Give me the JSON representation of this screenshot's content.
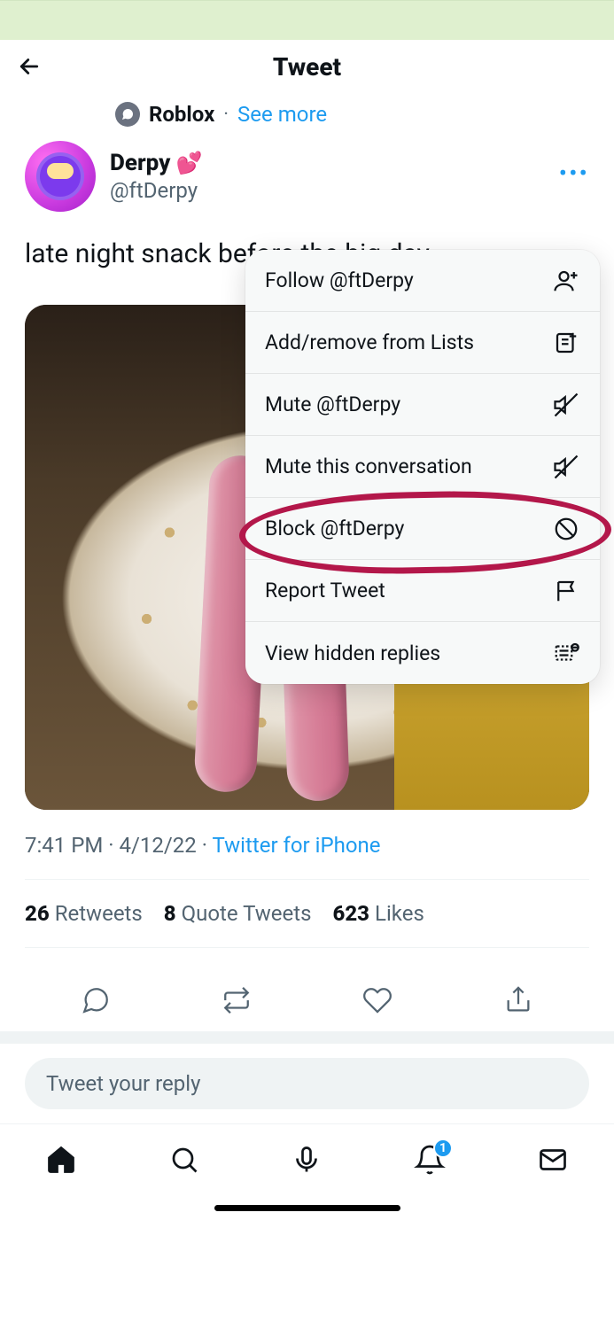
{
  "header": {
    "title": "Tweet"
  },
  "topic": {
    "name": "Roblox",
    "see_more": "See more"
  },
  "user": {
    "display_name": "Derpy",
    "emoji": "💕",
    "handle": "@ftDerpy"
  },
  "tweet_text": "late night snack before the big day",
  "meta": {
    "time": "7:41 PM",
    "date": "4/12/22",
    "source": "Twitter for iPhone"
  },
  "stats": {
    "retweets_count": "26",
    "retweets_label": "Retweets",
    "quotes_count": "8",
    "quotes_label": "Quote Tweets",
    "likes_count": "623",
    "likes_label": "Likes"
  },
  "reply_placeholder": "Tweet your reply",
  "notification_badge": "1",
  "menu": {
    "items": [
      {
        "label": "Follow @ftDerpy",
        "icon": "follow"
      },
      {
        "label": "Add/remove from Lists",
        "icon": "list"
      },
      {
        "label": "Mute @ftDerpy",
        "icon": "mute"
      },
      {
        "label": "Mute this conversation",
        "icon": "mute"
      },
      {
        "label": "Block @ftDerpy",
        "icon": "block"
      },
      {
        "label": "Report Tweet",
        "icon": "report"
      },
      {
        "label": "View hidden replies",
        "icon": "hidden"
      }
    ]
  }
}
